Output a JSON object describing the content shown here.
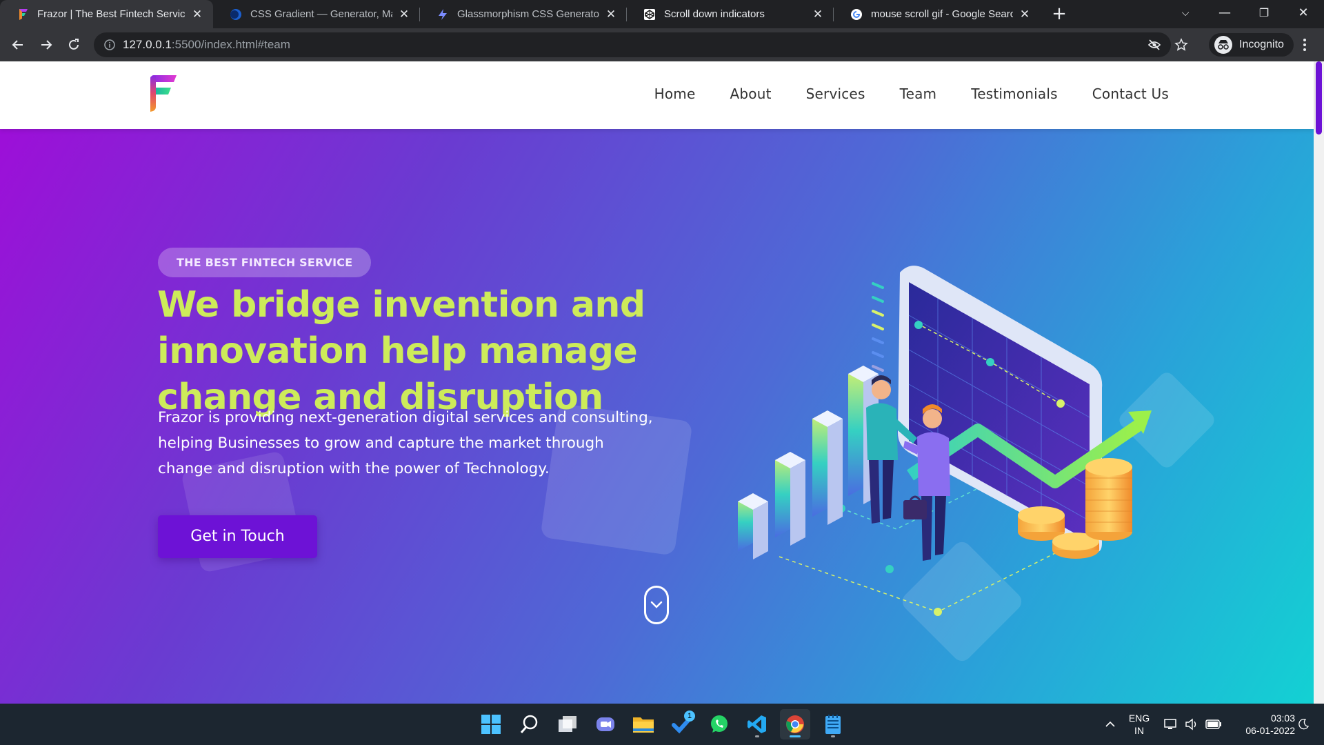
{
  "browser": {
    "tabs": [
      {
        "title": "Frazor | The Best Fintech Service",
        "active": true,
        "favicon": "frazor-logo-icon"
      },
      {
        "title": "CSS Gradient — Generator, Maker",
        "active": false,
        "favicon": "css-gradient-icon"
      },
      {
        "title": "Glassmorphism CSS Generator | H",
        "active": false,
        "favicon": "glassmorphism-icon"
      },
      {
        "title": "Scroll down indicators",
        "active": false,
        "favicon": "codepen-icon"
      },
      {
        "title": "mouse scroll gif - Google Search",
        "active": false,
        "favicon": "google-icon"
      }
    ],
    "address": {
      "host": "127.0.0.1",
      "rest": ":5500/index.html#team"
    },
    "profile_label": "Incognito"
  },
  "site": {
    "nav": [
      "Home",
      "About",
      "Services",
      "Team",
      "Testimonials",
      "Contact Us"
    ],
    "hero": {
      "badge": "THE BEST FINTECH SERVICE",
      "headline": "We bridge invention and innovation help manage change and disruption",
      "lead": "Frazor is providing next-generation digital services and consulting, helping Businesses to grow and capture the market through change and disruption with the power of Technology.",
      "cta": "Get in Touch"
    },
    "colors": {
      "accent": "#6d12d6",
      "headline": "#cdeb5a",
      "gradient_start": "#9d0fd8",
      "gradient_end": "#13d1d3"
    }
  },
  "taskbar": {
    "apps": [
      "windows-start-icon",
      "search-icon",
      "task-view-icon",
      "teams-chat-icon",
      "file-explorer-icon",
      "todo-icon",
      "whatsapp-icon",
      "vscode-icon",
      "chrome-icon",
      "notepad-icon"
    ],
    "todo_badge": "1",
    "lang_top": "ENG",
    "lang_bottom": "IN",
    "time": "03:03",
    "date": "06-01-2022"
  }
}
